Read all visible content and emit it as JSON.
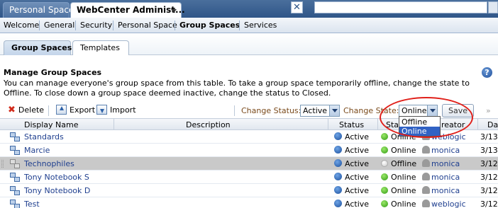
{
  "top_tabs": [
    {
      "label": "Personal Space"
    },
    {
      "label": "WebCenter Administ..."
    }
  ],
  "close_label": "✕",
  "menu": [
    "Welcome",
    "General",
    "Security",
    "Personal Space",
    "Group Spaces",
    "Services"
  ],
  "sub_tabs": [
    "Group Spaces",
    "Templates"
  ],
  "section": {
    "title": "Manage Group Spaces",
    "help": "?",
    "description": "You can manage everyone's group space from this table. To take a group space temporarily offline, change the state to Offline. To close down a group space deemed inactive, change the status to Closed."
  },
  "toolbar": {
    "delete": "Delete",
    "export": "Export",
    "import": "Import",
    "change_status_label": "Change Status:",
    "change_status_value": "Active",
    "change_state_label": "Change State:",
    "change_state_value": "Online",
    "save": "Save",
    "more": "»"
  },
  "state_options": [
    "Offline",
    "Online"
  ],
  "columns": [
    "Display Name",
    "Description",
    "Status",
    "Sta",
    "reator",
    "Da"
  ],
  "rows": [
    {
      "name": "Standards",
      "status": "Active",
      "state": "Online",
      "creator": "weblogic",
      "date": "3/13"
    },
    {
      "name": "Marcie",
      "status": "Active",
      "state": "Online",
      "creator": "monica",
      "date": "3/13"
    },
    {
      "name": "Technophiles",
      "status": "Active",
      "state": "Offline",
      "creator": "monica",
      "date": "3/12"
    },
    {
      "name": "Tony Notebook S",
      "status": "Active",
      "state": "Online",
      "creator": "monica",
      "date": "3/12"
    },
    {
      "name": "Tony Notebook D",
      "status": "Active",
      "state": "Online",
      "creator": "monica",
      "date": "3/12"
    },
    {
      "name": "Test",
      "status": "Active",
      "state": "Online",
      "creator": "weblogic",
      "date": "3/12"
    }
  ]
}
